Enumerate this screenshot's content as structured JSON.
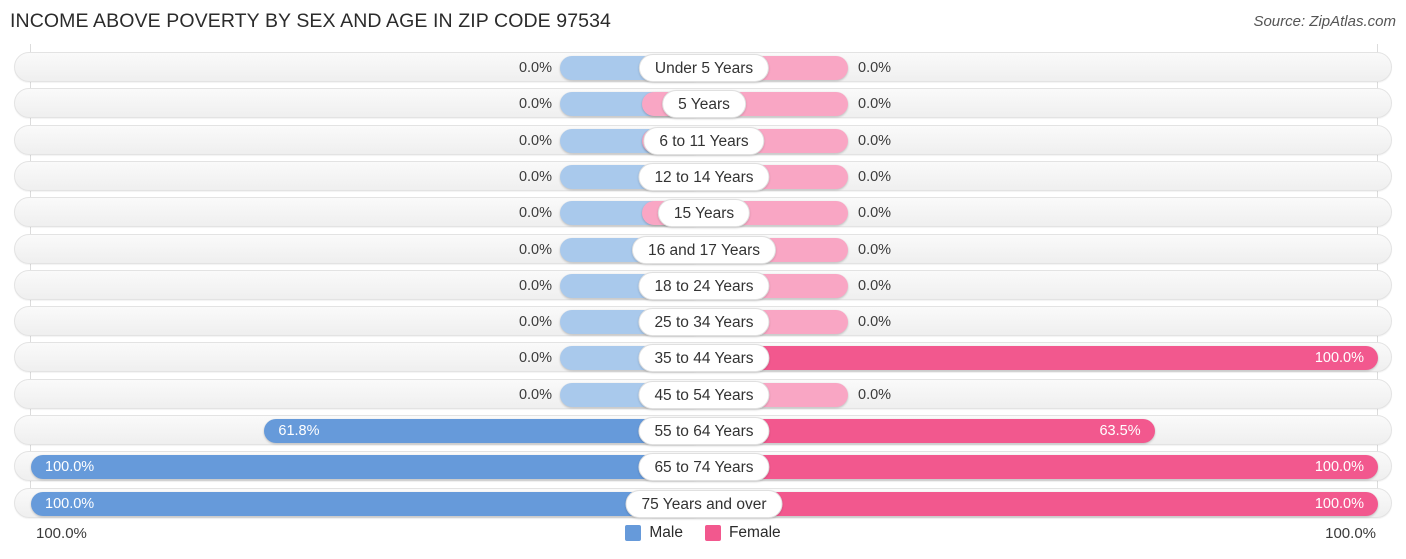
{
  "header": {
    "title": "INCOME ABOVE POVERTY BY SEX AND AGE IN ZIP CODE 97534",
    "source": "Source: ZipAtlas.com"
  },
  "legend": {
    "male_label": "Male",
    "female_label": "Female",
    "male_color": "#669ada",
    "female_color": "#f2588e"
  },
  "axis": {
    "left_end": "100.0%",
    "right_end": "100.0%"
  },
  "colors": {
    "male_zero": "#a9c9ec",
    "female_zero": "#f9a6c4",
    "male_active": "#669ada",
    "female_active": "#f2588e",
    "track": "#f4f4f4",
    "gridline": "#dcdcdc"
  },
  "chart_data": {
    "type": "bar",
    "title": "INCOME ABOVE POVERTY BY SEX AND AGE IN ZIP CODE 97534",
    "subtitle": "",
    "xlabel": "",
    "ylabel": "",
    "orientation": "horizontal",
    "style": "diverging-bidirectional",
    "xlim": [
      0,
      100
    ],
    "unit": "%",
    "grid": true,
    "legend_position": "bottom-center",
    "categories": [
      "Under 5 Years",
      "5 Years",
      "6 to 11 Years",
      "12 to 14 Years",
      "15 Years",
      "16 and 17 Years",
      "18 to 24 Years",
      "25 to 34 Years",
      "35 to 44 Years",
      "45 to 54 Years",
      "55 to 64 Years",
      "65 to 74 Years",
      "75 Years and over"
    ],
    "series": [
      {
        "name": "Male",
        "side": "left",
        "values": [
          0.0,
          0.0,
          0.0,
          0.0,
          0.0,
          0.0,
          0.0,
          0.0,
          0.0,
          0.0,
          61.8,
          100.0,
          100.0
        ],
        "labels": [
          "0.0%",
          "0.0%",
          "0.0%",
          "0.0%",
          "0.0%",
          "0.0%",
          "0.0%",
          "0.0%",
          "0.0%",
          "0.0%",
          "61.8%",
          "100.0%",
          "100.0%"
        ]
      },
      {
        "name": "Female",
        "side": "right",
        "values": [
          0.0,
          0.0,
          0.0,
          0.0,
          0.0,
          0.0,
          0.0,
          0.0,
          100.0,
          0.0,
          63.5,
          100.0,
          100.0
        ],
        "labels": [
          "0.0%",
          "0.0%",
          "0.0%",
          "0.0%",
          "0.0%",
          "0.0%",
          "0.0%",
          "0.0%",
          "100.0%",
          "0.0%",
          "63.5%",
          "100.0%",
          "100.0%"
        ]
      }
    ]
  }
}
